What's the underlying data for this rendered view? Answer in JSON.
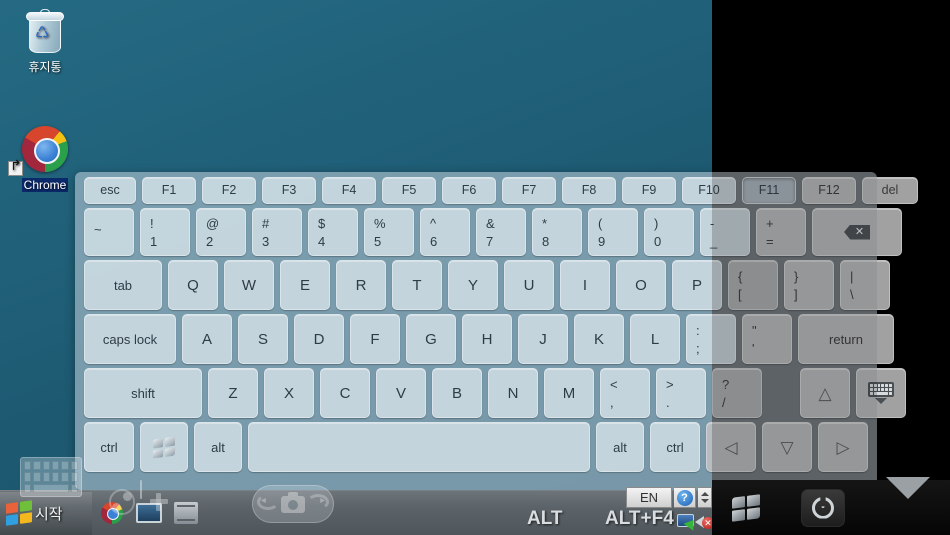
{
  "desktop": {
    "icons": [
      {
        "name": "recycle-bin",
        "label": "휴지통"
      },
      {
        "name": "chrome",
        "label": "Chrome"
      }
    ]
  },
  "keyboard": {
    "rows": {
      "function": [
        {
          "label": "esc",
          "w": "w-esc"
        },
        {
          "label": "F1",
          "w": "w-fn"
        },
        {
          "label": "F2",
          "w": "w-fn"
        },
        {
          "label": "F3",
          "w": "w-fn"
        },
        {
          "label": "F4",
          "w": "w-fn"
        },
        {
          "label": "F5",
          "w": "w-fn"
        },
        {
          "label": "F6",
          "w": "w-fn"
        },
        {
          "label": "F7",
          "w": "w-fn"
        },
        {
          "label": "F8",
          "w": "w-fn"
        },
        {
          "label": "F9",
          "w": "w-fn"
        },
        {
          "label": "F10",
          "w": "w-fn"
        },
        {
          "label": "F11",
          "w": "w-fn"
        },
        {
          "label": "F12",
          "w": "w-fn"
        },
        {
          "label": "del",
          "w": "w-del"
        }
      ],
      "number": [
        {
          "top": "~",
          "bottom": "",
          "w": "w-num"
        },
        {
          "top": "!",
          "bottom": "1",
          "w": "w-num"
        },
        {
          "top": "@",
          "bottom": "2",
          "w": "w-num"
        },
        {
          "top": "#",
          "bottom": "3",
          "w": "w-num"
        },
        {
          "top": "$",
          "bottom": "4",
          "w": "w-num"
        },
        {
          "top": "%",
          "bottom": "5",
          "w": "w-num"
        },
        {
          "top": "^",
          "bottom": "6",
          "w": "w-num"
        },
        {
          "top": "&",
          "bottom": "7",
          "w": "w-num"
        },
        {
          "top": "*",
          "bottom": "8",
          "w": "w-num"
        },
        {
          "top": "(",
          "bottom": "9",
          "w": "w-num"
        },
        {
          "top": ")",
          "bottom": "0",
          "w": "w-num"
        },
        {
          "top": "-",
          "bottom": "_",
          "w": "w-num"
        },
        {
          "top": "+",
          "bottom": "=",
          "w": "w-num"
        }
      ],
      "backspace_label": "backspace-icon",
      "top_alpha": [
        {
          "label": "tab",
          "w": "w-tab",
          "kind": "word"
        },
        {
          "label": "Q",
          "w": "w-alpha",
          "kind": "alpha"
        },
        {
          "label": "W",
          "w": "w-alpha",
          "kind": "alpha"
        },
        {
          "label": "E",
          "w": "w-alpha",
          "kind": "alpha"
        },
        {
          "label": "R",
          "w": "w-alpha",
          "kind": "alpha"
        },
        {
          "label": "T",
          "w": "w-alpha",
          "kind": "alpha"
        },
        {
          "label": "Y",
          "w": "w-alpha",
          "kind": "alpha"
        },
        {
          "label": "U",
          "w": "w-alpha",
          "kind": "alpha"
        },
        {
          "label": "I",
          "w": "w-alpha",
          "kind": "alpha"
        },
        {
          "label": "O",
          "w": "w-alpha",
          "kind": "alpha"
        },
        {
          "label": "P",
          "w": "w-alpha",
          "kind": "alpha"
        }
      ],
      "top_alpha_dual": [
        {
          "top": "{",
          "bottom": "[",
          "w": "w-num"
        },
        {
          "top": "}",
          "bottom": "]",
          "w": "w-num"
        },
        {
          "top": "|",
          "bottom": "\\",
          "w": "w-num"
        }
      ],
      "home": [
        {
          "label": "caps lock",
          "w": "w-caps",
          "kind": "word"
        },
        {
          "label": "A",
          "w": "w-alpha",
          "kind": "alpha"
        },
        {
          "label": "S",
          "w": "w-alpha",
          "kind": "alpha"
        },
        {
          "label": "D",
          "w": "w-alpha",
          "kind": "alpha"
        },
        {
          "label": "F",
          "w": "w-alpha",
          "kind": "alpha"
        },
        {
          "label": "G",
          "w": "w-alpha",
          "kind": "alpha"
        },
        {
          "label": "H",
          "w": "w-alpha",
          "kind": "alpha"
        },
        {
          "label": "J",
          "w": "w-alpha",
          "kind": "alpha"
        },
        {
          "label": "K",
          "w": "w-alpha",
          "kind": "alpha"
        },
        {
          "label": "L",
          "w": "w-alpha",
          "kind": "alpha"
        }
      ],
      "home_dual": [
        {
          "top": ":",
          "bottom": ";",
          "w": "w-num"
        },
        {
          "top": "\"",
          "bottom": "'",
          "w": "w-num"
        }
      ],
      "return_label": "return",
      "bottom_alpha": [
        {
          "label": "shift",
          "w": "w-shift",
          "kind": "word"
        },
        {
          "label": "Z",
          "w": "w-alpha",
          "kind": "alpha"
        },
        {
          "label": "X",
          "w": "w-alpha",
          "kind": "alpha"
        },
        {
          "label": "C",
          "w": "w-alpha",
          "kind": "alpha"
        },
        {
          "label": "V",
          "w": "w-alpha",
          "kind": "alpha"
        },
        {
          "label": "B",
          "w": "w-alpha",
          "kind": "alpha"
        },
        {
          "label": "N",
          "w": "w-alpha",
          "kind": "alpha"
        },
        {
          "label": "M",
          "w": "w-alpha",
          "kind": "alpha"
        }
      ],
      "bottom_alpha_dual": [
        {
          "top": "<",
          "bottom": ",",
          "w": "w-num"
        },
        {
          "top": ">",
          "bottom": ".",
          "w": "w-num"
        },
        {
          "top": "?",
          "bottom": "/",
          "w": "w-num"
        }
      ],
      "control": [
        {
          "label": "ctrl",
          "w": "w-ctrl",
          "kind": "word"
        },
        {
          "label": "alt",
          "w": "w-alt",
          "kind": "word"
        },
        {
          "label": "alt",
          "w": "w-alt",
          "kind": "word"
        },
        {
          "label": "ctrl",
          "w": "w-ctrl",
          "kind": "word"
        }
      ],
      "windows_key": "windows-logo-key",
      "space_key": "space-bar",
      "arrow_up": "arrow-up-key",
      "hide_keyboard": "hide-keyboard-key",
      "arrow_left": "arrow-left-key",
      "arrow_down": "arrow-down-key",
      "arrow_right": "arrow-right-key"
    }
  },
  "taskbar": {
    "start_label": "시작",
    "overlay_labels": {
      "alt": "ALT",
      "alt_f4": "ALT+F4"
    },
    "tray": {
      "language": "EN",
      "help": "?",
      "network": "network-icon",
      "volume": "volume-muted-icon"
    },
    "items": [
      {
        "name": "taskbar-chrome"
      },
      {
        "name": "taskbar-monitor"
      },
      {
        "name": "taskbar-explorer"
      }
    ]
  },
  "navbar": {
    "items": [
      {
        "name": "nav-windows-button"
      },
      {
        "name": "nav-power-button"
      },
      {
        "name": "nav-hide-button"
      }
    ]
  },
  "overlay_controls": [
    {
      "name": "floating-keyboard-toggle"
    },
    {
      "name": "floating-gamepad-toggle"
    },
    {
      "name": "floating-screen-rotate-toggle"
    }
  ],
  "colors": {
    "desktop_teal": "#1f6079",
    "desktop_black": "#000000",
    "key_blue": "#d6e2e9",
    "key_gray": "#c4c4c4",
    "taskbar": "#5c6469"
  }
}
